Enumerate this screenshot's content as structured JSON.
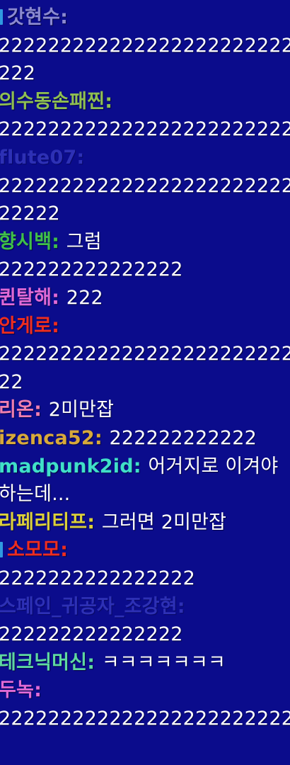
{
  "chat": {
    "messages": [
      {
        "user": "갓현수",
        "user_color": "#8b8ad0",
        "badge": true,
        "faded": false,
        "text": "",
        "continuation": [
          "2222222222222222222222222",
          "222"
        ]
      },
      {
        "user": "의수동손패찐",
        "user_color": "#8fbf52",
        "badge": false,
        "faded": false,
        "text": "",
        "continuation": [
          "2222222222222222222222222"
        ]
      },
      {
        "user": "flute07",
        "user_color": "#4a4fd8",
        "badge": false,
        "faded": true,
        "text": "",
        "continuation": [
          "2222222222222222222222222",
          "22222"
        ]
      },
      {
        "user": "향시백",
        "user_color": "#3fbf4a",
        "badge": false,
        "faded": false,
        "text": "그럼",
        "continuation": [
          "222222222222222"
        ]
      },
      {
        "user": "퀸탈해",
        "user_color": "#e06ad6",
        "badge": false,
        "faded": false,
        "text": "222",
        "continuation": []
      },
      {
        "user": "안게로",
        "user_color": "#ee2d1f",
        "badge": false,
        "faded": false,
        "text": "",
        "continuation": [
          "2222222222222222222222222",
          "22"
        ]
      },
      {
        "user": "리온",
        "user_color": "#f07fb0",
        "badge": false,
        "faded": false,
        "text": "2미만잡",
        "continuation": []
      },
      {
        "user": "izenca52",
        "user_color": "#d8a93a",
        "badge": false,
        "faded": false,
        "text": "222222222222",
        "continuation": []
      },
      {
        "user": "madpunk2id",
        "user_color": "#40e0c8",
        "badge": false,
        "faded": false,
        "text": "어거지로 이겨야",
        "continuation": [
          "하는데..."
        ]
      },
      {
        "user": "라페리티프",
        "user_color": "#dcd03a",
        "badge": false,
        "faded": false,
        "text": "그러면 2미만잡",
        "continuation": []
      },
      {
        "user": "소모모",
        "user_color": "#ee2d1f",
        "badge": true,
        "faded": false,
        "text": "",
        "continuation": [
          "2222222222222222"
        ]
      },
      {
        "user": "스페인_귀공자_조강현",
        "user_color": "#4a4fd8",
        "badge": false,
        "faded": true,
        "text": "",
        "continuation": [
          "222222222222222"
        ]
      },
      {
        "user": "테크닉머신",
        "user_color": "#5fd8a0",
        "badge": false,
        "faded": false,
        "text": "ㅋㅋㅋㅋㅋㅋㅋ",
        "continuation": []
      },
      {
        "user": "두녹",
        "user_color": "#e06ad6",
        "badge": false,
        "faded": false,
        "text": "",
        "continuation": [
          "2222222222222222222222222"
        ]
      }
    ]
  }
}
